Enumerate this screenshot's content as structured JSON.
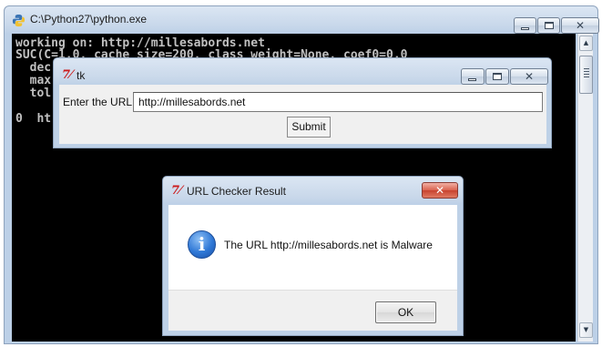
{
  "console": {
    "title": "C:\\Python27\\python.exe",
    "lines": [
      "working on: http://millesabords.net",
      "SUC(C=1.0, cache_size=200, class_weight=None, coef0=0.0",
      "  dec",
      "  max",
      "  tol",
      "0  ht"
    ]
  },
  "tk_window": {
    "logo_glyph": "7⁄",
    "title": "tk",
    "url_label": "Enter the URL:",
    "url_value": "http://millesabords.net",
    "submit_label": "Submit"
  },
  "dialog": {
    "logo_glyph": "7⁄",
    "title": "URL Checker Result",
    "icon": "info-icon",
    "message": "The URL http://millesabords.net is Malware",
    "ok_label": "OK"
  },
  "colors": {
    "console_bg": "#000000",
    "console_text": "#c0c0c0",
    "tk_logo": "#cc1a1a",
    "close_button": "#c7432e",
    "info_icon": "#2f78d6"
  }
}
